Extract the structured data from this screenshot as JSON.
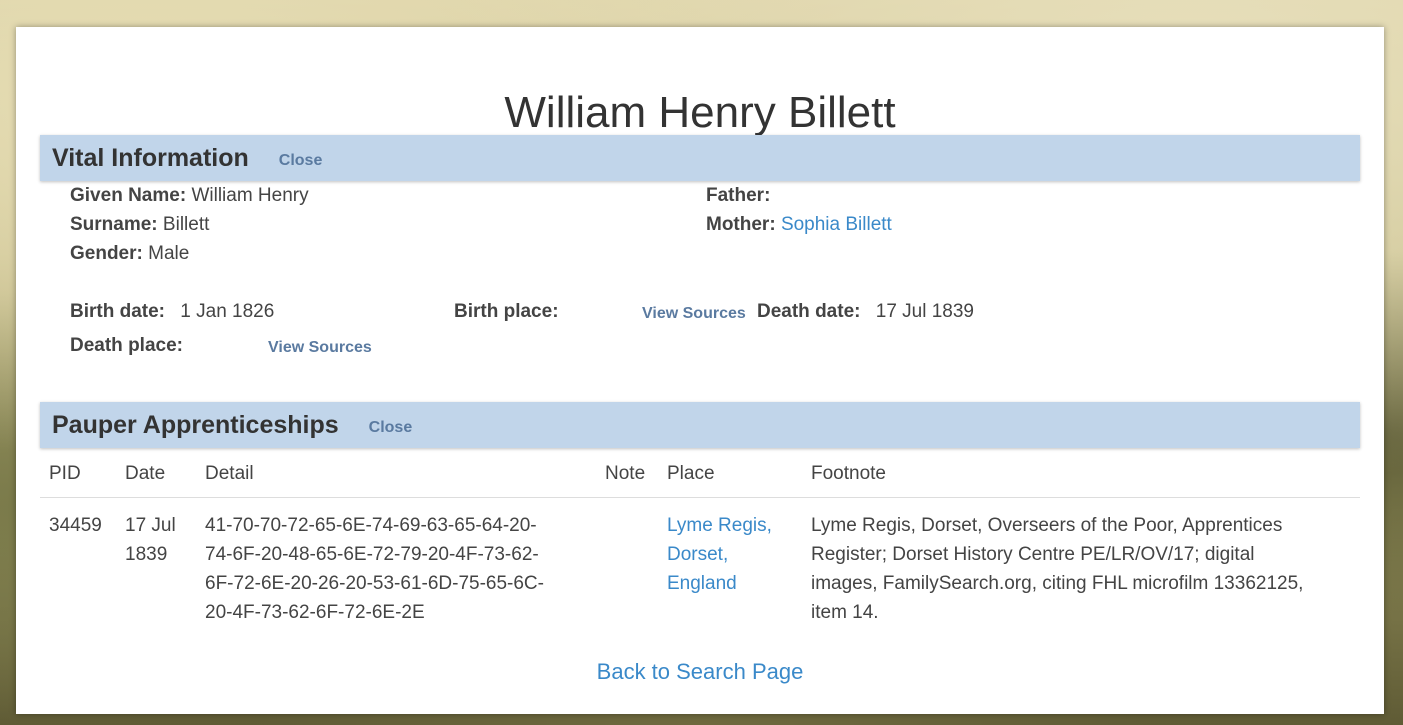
{
  "person": {
    "full_name": "William Henry Billett"
  },
  "vital": {
    "title": "Vital Information",
    "close_label": "Close",
    "given_name_label": "Given Name:",
    "given_name": "William Henry",
    "surname_label": "Surname:",
    "surname": "Billett",
    "gender_label": "Gender:",
    "gender": "Male",
    "father_label": "Father:",
    "father": "",
    "mother_label": "Mother:",
    "mother": "Sophia Billett",
    "birth_date_label": "Birth date:",
    "birth_date": "1 Jan 1826",
    "birth_place_label": "Birth place:",
    "birth_place_sources": "View Sources",
    "death_date_label": "Death date:",
    "death_date": "17 Jul 1839",
    "death_place_label": "Death place:",
    "death_place_sources": "View Sources"
  },
  "pauper": {
    "title": "Pauper Apprenticeships",
    "close_label": "Close",
    "headers": {
      "pid": "PID",
      "date": "Date",
      "detail": "Detail",
      "note": "Note",
      "place": "Place",
      "footnote": "Footnote"
    },
    "rows": [
      {
        "pid": "34459",
        "date_line1": "17 Jul",
        "date_line2": "1839",
        "detail_line1": "41-70-70-72-65-6E-74-69-63-65-64-20-",
        "detail_line2": "74-6F-20-48-65-6E-72-79-20-4F-73-62-",
        "detail_line3": "6F-72-6E-20-26-20-53-61-6D-75-65-6C-",
        "detail_line4": "20-4F-73-62-6F-72-6E-2E",
        "note": "",
        "place_line1": "Lyme Regis,",
        "place_line2": "Dorset,",
        "place_line3": "England",
        "footnote_line1": "Lyme Regis, Dorset, Overseers of the Poor, Apprentices",
        "footnote_line2": "Register; Dorset History Centre PE/LR/OV/17; digital",
        "footnote_line3": "images, FamilySearch.org, citing FHL microfilm 13362125,",
        "footnote_line4": "item 14."
      }
    ]
  },
  "footer": {
    "back_label": "Back to Search Page"
  },
  "colors": {
    "header_band": "#c1d5ea",
    "link": "#3a89c9",
    "close_link": "#5a7aa0"
  }
}
